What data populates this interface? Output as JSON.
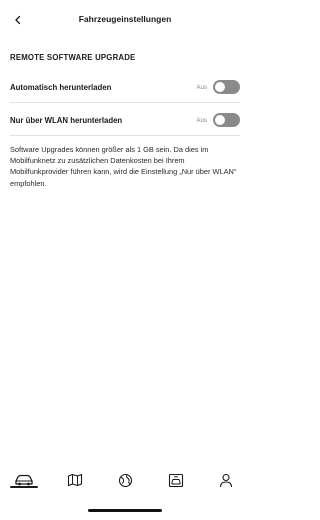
{
  "header": {
    "title": "Fahrzeugeinstellungen",
    "back_icon": "chevron-left-icon"
  },
  "section": {
    "title": "REMOTE SOFTWARE UPGRADE"
  },
  "settings": [
    {
      "label": "Automatisch herunterladen",
      "state": "Aus",
      "enabled": false
    },
    {
      "label": "Nur über WLAN herunterladen",
      "state": "Aus",
      "enabled": false
    }
  ],
  "description": "Software Upgrades können größer als 1 GB sein. Da dies im Mobilfunknetz zu zusätzlichen Datenkosten bei Ihrem Mobilfunkprovider führen kann, wird die Einstellung „Nur über WLAN“ empfohlen.",
  "tabbar": {
    "tabs": [
      {
        "icon": "car-icon",
        "active": true
      },
      {
        "icon": "map-icon",
        "active": false
      },
      {
        "icon": "globe-icon",
        "active": false
      },
      {
        "icon": "service-icon",
        "active": false
      },
      {
        "icon": "profile-icon",
        "active": false
      }
    ]
  },
  "colors": {
    "toggle_off": "#8a8a8a",
    "text": "#1a1a1a",
    "muted": "#8a8a8a",
    "divider": "#e3e3e3"
  }
}
